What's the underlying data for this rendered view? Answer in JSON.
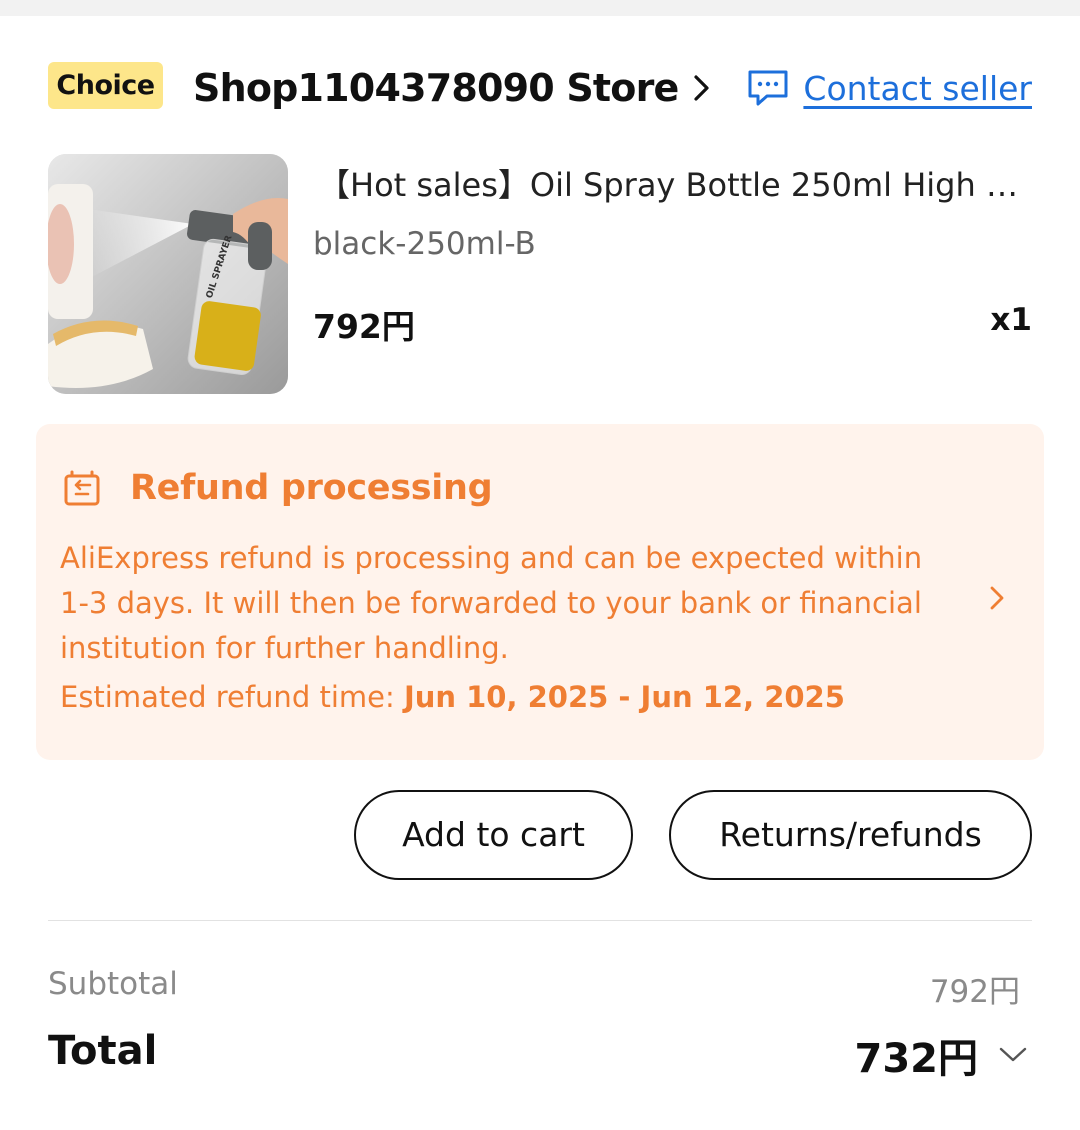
{
  "store": {
    "badge": "Choice",
    "name": "Shop1104378090 Store",
    "contact_label": "Contact seller"
  },
  "product": {
    "title": "【Hot sales】Oil Spray Bottle 250ml High …",
    "variant": "black-250ml-B",
    "price": "792円",
    "quantity": "x1",
    "image_label": "OIL SPRAYER"
  },
  "refund": {
    "title": "Refund processing",
    "description": "AliExpress refund is processing and can be expected within 1-3 days. It will then be forwarded to your bank or financial institution for further handling.",
    "estimate_label": "Estimated refund time: ",
    "estimate_range": "Jun 10, 2025 - Jun 12, 2025"
  },
  "actions": {
    "add_to_cart": "Add to cart",
    "returns": "Returns/refunds"
  },
  "summary": {
    "subtotal_label": "Subtotal",
    "subtotal_value": "792円",
    "total_label": "Total",
    "total_value": "732円"
  },
  "colors": {
    "accent_orange": "#ef7e33",
    "link_blue": "#1d6fdb",
    "choice_yellow": "#fde68a",
    "refund_bg": "#fff3ec"
  }
}
